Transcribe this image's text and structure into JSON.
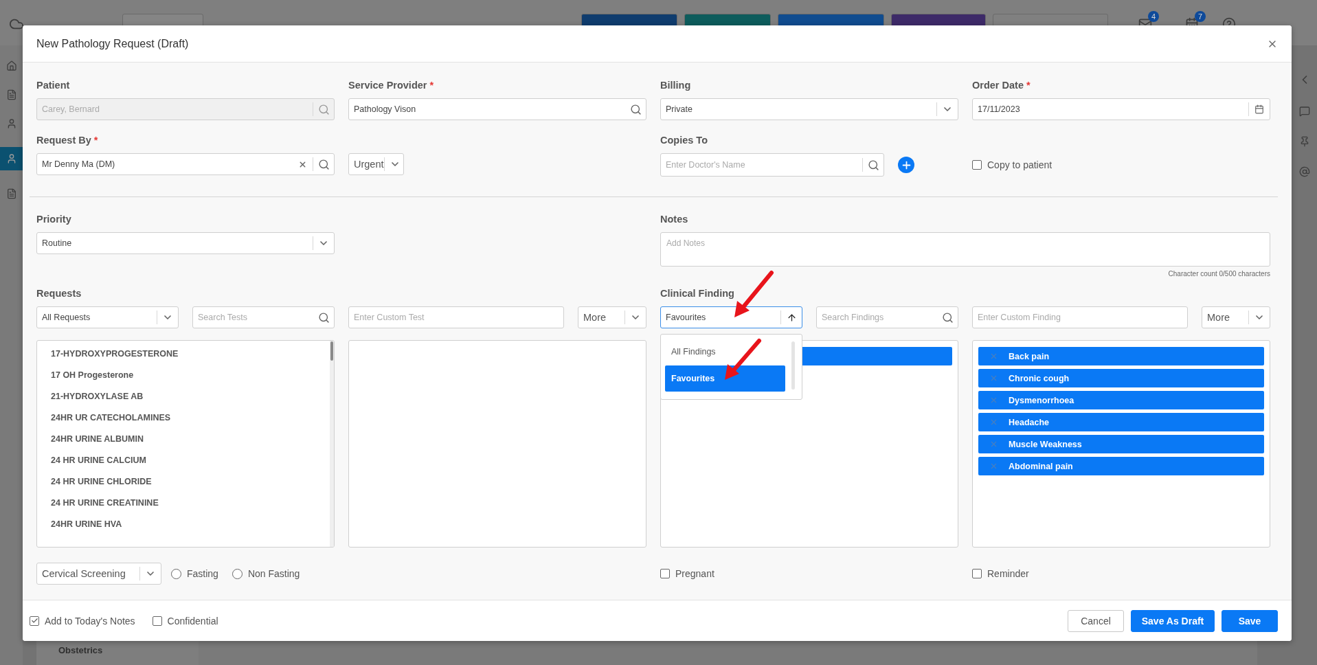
{
  "background": {
    "badges": [
      "4",
      "7"
    ],
    "sidebar_item": "Obstetrics"
  },
  "dialog": {
    "title": "New Pathology Request (Draft)"
  },
  "patient": {
    "label": "Patient",
    "value": "Carey, Bernard",
    "disabled": true
  },
  "service_provider": {
    "label": "Service Provider",
    "mark": "*",
    "value": "Pathology Vison"
  },
  "billing": {
    "label": "Billing",
    "value": "Private"
  },
  "order_date": {
    "label": "Order Date",
    "mark": "*",
    "value": "17/11/2023"
  },
  "request_by": {
    "label": "Request By",
    "mark": "*",
    "value": "Mr Denny Ma (DM)"
  },
  "urgency": {
    "value": "Urgent"
  },
  "copies_to": {
    "label": "Copies To",
    "placeholder": "Enter Doctor's Name"
  },
  "copy_to_patient": {
    "label": "Copy to patient",
    "checked": false
  },
  "priority": {
    "label": "Priority",
    "value": "Routine"
  },
  "notes": {
    "label": "Notes",
    "placeholder": "Add Notes",
    "char_count": "Character count 0/500 characters"
  },
  "requests": {
    "label": "Requests",
    "filter": "All Requests",
    "search_placeholder": "Search Tests",
    "custom_placeholder": "Enter Custom Test",
    "more": "More",
    "tests": [
      "17-HYDROXYPROGESTERONE",
      "17 OH Progesterone",
      "21-HYDROXYLASE AB",
      "24HR UR CATECHOLAMINES",
      "24HR URINE ALBUMIN",
      "24 HR URINE CALCIUM",
      "24 HR URINE CHLORIDE",
      "24 HR URINE CREATININE",
      "24HR URINE HVA"
    ]
  },
  "clinical_finding": {
    "label": "Clinical Finding",
    "filter": "Favourites",
    "search_placeholder": "Search Findings",
    "custom_placeholder": "Enter Custom Finding",
    "more": "More",
    "dropdown": [
      {
        "label": "All Findings",
        "selected": false
      },
      {
        "label": "Favourites",
        "selected": true
      }
    ],
    "findings": [
      "Back pain",
      "Chronic cough",
      "Dysmenorrhoea",
      "Headache",
      "Muscle Weakness",
      "Abdominal pain"
    ]
  },
  "cervical_screening": {
    "value": "Cervical Screening"
  },
  "fasting_options": [
    {
      "label": "Fasting",
      "selected": false
    },
    {
      "label": "Non Fasting",
      "selected": false
    }
  ],
  "pregnant": {
    "label": "Pregnant",
    "checked": false
  },
  "reminder": {
    "label": "Reminder",
    "checked": false
  },
  "footer": {
    "add_to_notes": {
      "label": "Add to Today's Notes",
      "checked": true
    },
    "confidential": {
      "label": "Confidential",
      "checked": false
    },
    "buttons": [
      {
        "label": "Cancel",
        "kind": "secondary"
      },
      {
        "label": "Save As Draft",
        "kind": "primary"
      },
      {
        "label": "Save",
        "kind": "primary"
      }
    ]
  }
}
